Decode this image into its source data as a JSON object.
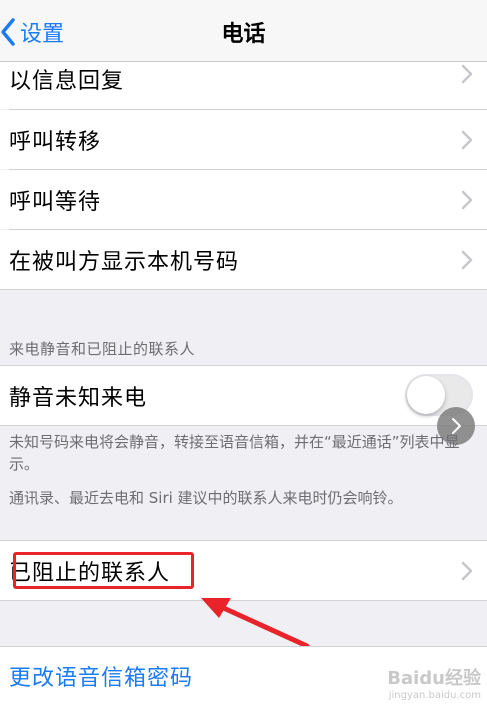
{
  "nav": {
    "back_label": "设置",
    "title": "电话"
  },
  "group1": [
    {
      "label": "以信息回复"
    },
    {
      "label": "呼叫转移"
    },
    {
      "label": "呼叫等待"
    },
    {
      "label": "在被叫方显示本机号码"
    }
  ],
  "silence": {
    "header": "来电静音和已阻止的联系人",
    "row_label": "静音未知来电",
    "toggle_on": false,
    "footer1": "未知号码来电将会静音，转接至语音信箱，并在“最近通话”列表中显示。",
    "footer2": "通讯录、最近去电和 Siri 建议中的联系人来电时仍会响铃。"
  },
  "blocked": {
    "label": "已阻止的联系人"
  },
  "voicemail": {
    "label": "更改语音信箱密码"
  },
  "watermark": {
    "main": "Baidu经验",
    "sub": "jingyan.baidu.com"
  },
  "colors": {
    "accent": "#1a7cf5",
    "annotation": "#e8242a"
  }
}
